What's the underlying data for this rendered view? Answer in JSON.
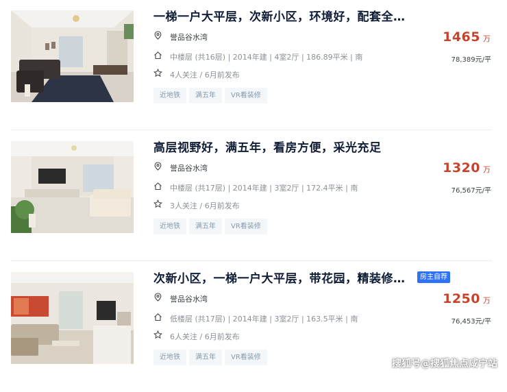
{
  "colors": {
    "price": "#c8432b",
    "title": "#101d37",
    "badge": "#3072f6",
    "tag_bg": "#f4f7f9"
  },
  "listings": [
    {
      "title": "一梯一户大平层，次新小区，环境好，配套全，…",
      "community": "誉品谷水湾",
      "info": "中楼层 (共16层) | 2014年建 | 4室2厅 | 186.89平米 | 南",
      "follow": "4人关注 / 6月前发布",
      "tags": [
        "近地铁",
        "满五年",
        "VR看装修"
      ],
      "price": "1465",
      "price_unit": "万",
      "unit_price": "78,389元/平",
      "badge": ""
    },
    {
      "title": "高层视野好，满五年，看房方便，采光充足",
      "community": "誉品谷水湾",
      "info": "中楼层 (共17层) | 2014年建 | 3室2厅 | 172.4平米 | 南",
      "follow": "3人关注 / 6月前发布",
      "tags": [
        "近地铁",
        "满五年",
        "VR看装修"
      ],
      "price": "1320",
      "price_unit": "万",
      "unit_price": "76,567元/平",
      "badge": ""
    },
    {
      "title": "次新小区，一梯一户大平层，带花园，精装修保…",
      "community": "誉品谷水湾",
      "info": "低楼层 (共17层) | 2014年建 | 3室2厅 | 163.5平米 | 南",
      "follow": "6人关注 / 6月前发布",
      "tags": [
        "近地铁",
        "满五年",
        "VR看装修"
      ],
      "price": "1250",
      "price_unit": "万",
      "unit_price": "76,453元/平",
      "badge": "房主自荐"
    }
  ],
  "icons": {
    "community": "location-pin-icon",
    "info": "house-icon",
    "follow": "star-icon"
  },
  "watermark": "搜狐号@搜狐焦点咸宁站"
}
